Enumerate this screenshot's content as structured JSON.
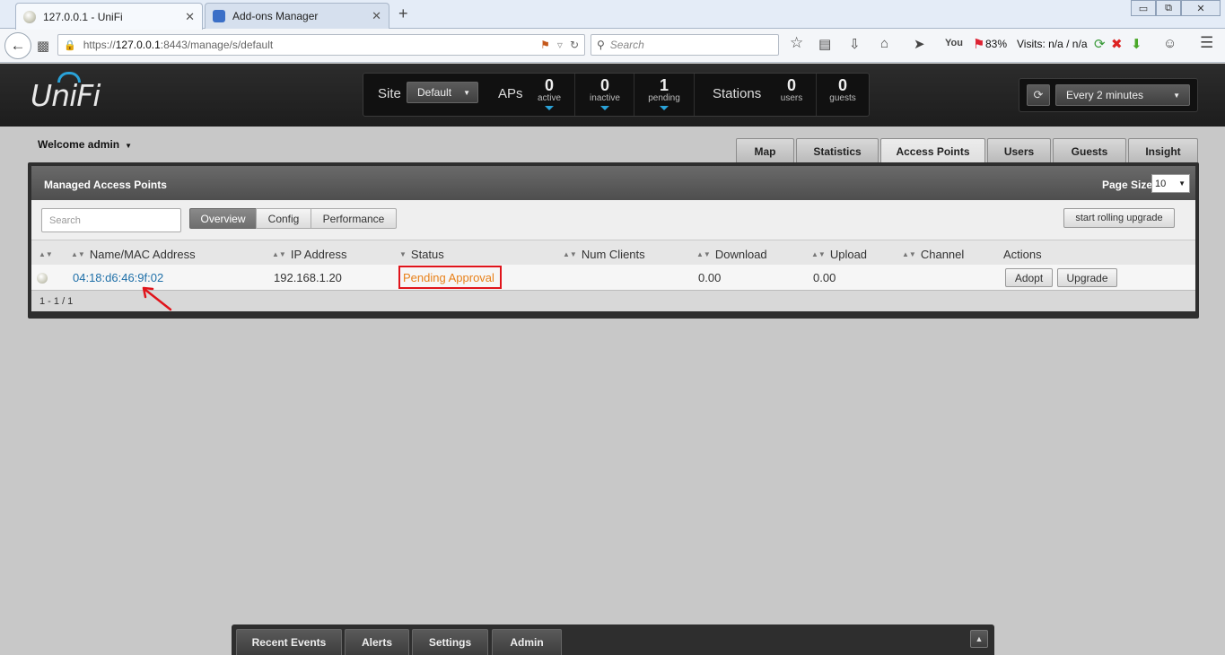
{
  "browser": {
    "tabs": [
      {
        "title": "127.0.0.1 - UniFi",
        "close": "✕"
      },
      {
        "title": "Add-ons Manager",
        "close": "✕"
      }
    ],
    "new_tab": "+",
    "window_controls": {
      "minimize": "▭",
      "restore": "⧉",
      "close": "✕"
    },
    "url": {
      "scheme": "https://",
      "host": "127.0.0.1",
      "rest": ":8443/manage/s/default"
    },
    "search_placeholder": "Search",
    "zoom_text": "83%",
    "visits_text": "Visits: n/a / n/a"
  },
  "unifi": {
    "logo": "UniFi",
    "site_label": "Site",
    "site_value": "Default",
    "aps_label": "APs",
    "ap_stats": [
      {
        "num": "0",
        "sub": "active"
      },
      {
        "num": "0",
        "sub": "inactive"
      },
      {
        "num": "1",
        "sub": "pending"
      }
    ],
    "stations_label": "Stations",
    "station_stats": [
      {
        "num": "0",
        "sub": "users"
      },
      {
        "num": "0",
        "sub": "guests"
      }
    ],
    "refresh_value": "Every 2 minutes",
    "welcome": "Welcome admin",
    "nav_tabs": [
      "Map",
      "Statistics",
      "Access Points",
      "Users",
      "Guests",
      "Insight"
    ],
    "active_nav_tab": "Access Points"
  },
  "panel": {
    "title": "Managed Access Points",
    "page_size_label": "Page Size",
    "page_size_value": "10",
    "search_placeholder": "Search",
    "views": [
      "Overview",
      "Config",
      "Performance"
    ],
    "active_view": "Overview",
    "rolling_upgrade": "start rolling upgrade",
    "columns": [
      "Name/MAC Address",
      "IP Address",
      "Status",
      "Num Clients",
      "Download",
      "Upload",
      "Channel",
      "Actions"
    ],
    "rows": [
      {
        "name": "04:18:d6:46:9f:02",
        "ip": "192.168.1.20",
        "status": "Pending Approval",
        "clients": "",
        "download": "0.00",
        "upload": "0.00",
        "channel": "",
        "actions": [
          "Adopt",
          "Upgrade"
        ]
      }
    ],
    "pager": "1 - 1 / 1"
  },
  "drawer": {
    "tabs": [
      "Recent Events",
      "Alerts",
      "Settings",
      "Admin"
    ],
    "toggle": "▲"
  },
  "colors": {
    "accent": "#2aa2d8",
    "link": "#1e6fa8",
    "pending_text": "#e8811a",
    "highlight_box": "#e0141b"
  }
}
